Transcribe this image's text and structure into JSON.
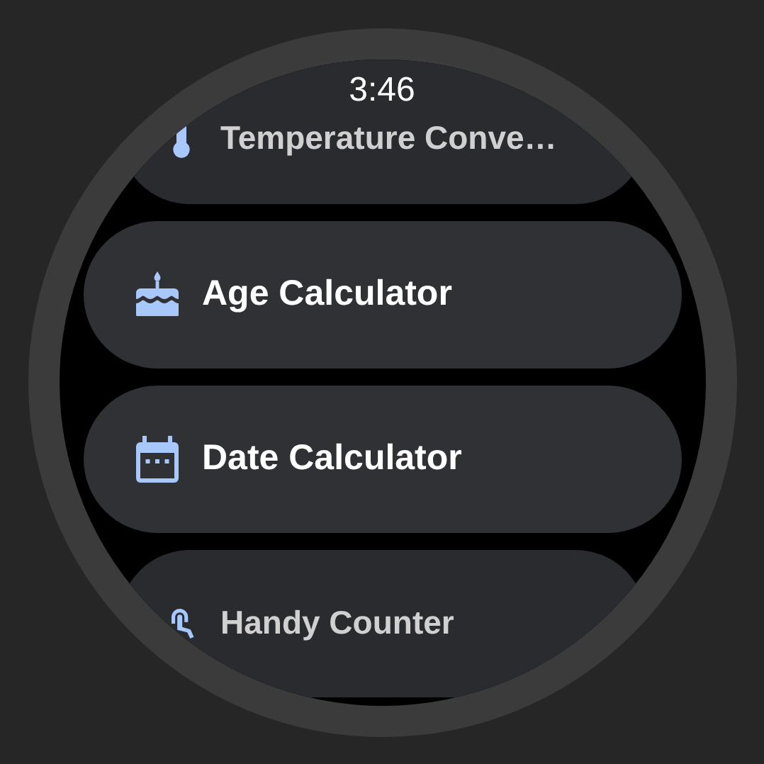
{
  "status": {
    "time": "3:46"
  },
  "items": [
    {
      "label": "Temperature Conve…",
      "kind": "thermometer"
    },
    {
      "label": "Age Calculator",
      "kind": "cake"
    },
    {
      "label": "Date Calculator",
      "kind": "calendar"
    },
    {
      "label": "Handy Counter",
      "kind": "touch"
    }
  ]
}
